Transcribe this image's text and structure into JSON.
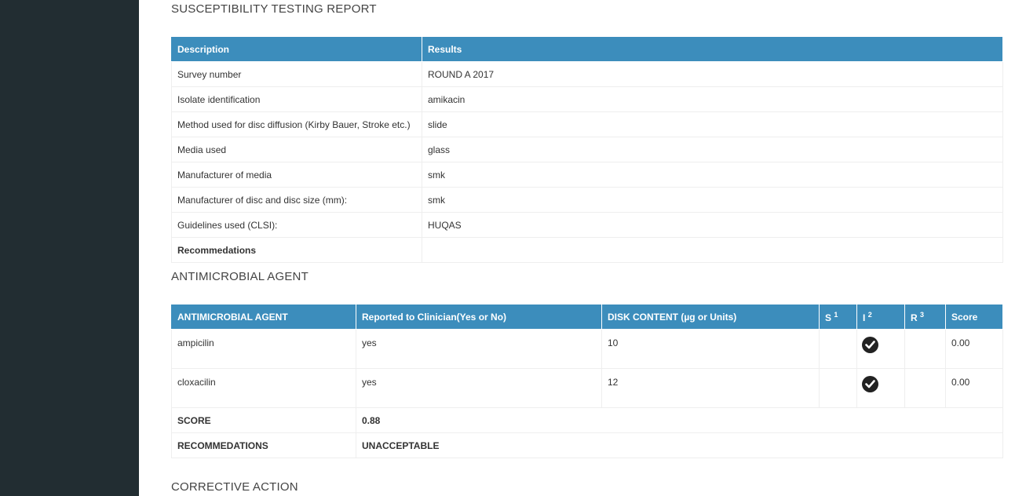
{
  "report": {
    "title": "SUSCEPTIBILITY TESTING REPORT",
    "headers": [
      "Description",
      "Results"
    ],
    "rows": [
      {
        "label": "Survey number",
        "value": "ROUND A 2017"
      },
      {
        "label": "Isolate identification",
        "value": "amikacin"
      },
      {
        "label": "Method used for disc diffusion (Kirby Bauer, Stroke etc.)",
        "value": "slide"
      },
      {
        "label": "Media used",
        "value": "glass"
      },
      {
        "label": "Manufacturer of media",
        "value": "smk"
      },
      {
        "label": "Manufacturer of disc and disc size (mm):",
        "value": "smk"
      },
      {
        "label": "Guidelines used (CLSI):",
        "value": "HUQAS"
      },
      {
        "label": "Recommedations",
        "value": ""
      }
    ]
  },
  "antimicrobial": {
    "title": "ANTIMICROBIAL AGENT",
    "headers": {
      "agent": "ANTIMICROBIAL AGENT",
      "reported": "Reported to Clinician(Yes or No)",
      "disk": "DISK CONTENT (µg or Units)",
      "s": "S",
      "s_sup": "1",
      "i": "I",
      "i_sup": "2",
      "r": "R",
      "r_sup": "3",
      "score": "Score"
    },
    "rows": [
      {
        "agent": "ampicilin",
        "reported": "yes",
        "disk": "10",
        "result": "I",
        "score": "0.00"
      },
      {
        "agent": "cloxacilin",
        "reported": "yes",
        "disk": "12",
        "result": "I",
        "score": "0.00"
      }
    ],
    "score_label": "SCORE",
    "score_value": "0.88",
    "recommendations_label": "RECOMMEDATIONS",
    "recommendations_value": "UNACCEPTABLE"
  },
  "corrective": {
    "title": "CORRECTIVE ACTION"
  },
  "colors": {
    "sidebar": "#222d32",
    "table_header": "#3c8dbc"
  },
  "icons": {
    "selected_result": "check-circle-icon"
  }
}
